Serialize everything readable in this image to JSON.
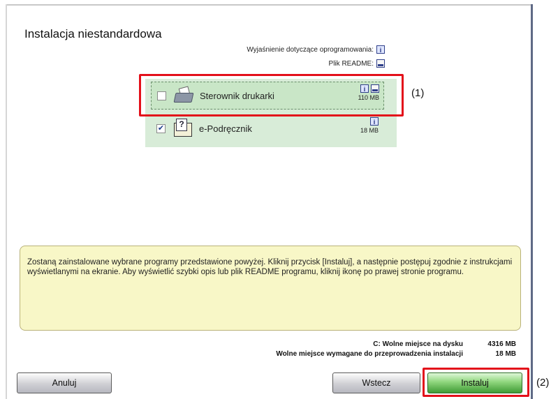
{
  "title": "Instalacja niestandardowa",
  "info": {
    "explanation_label": "Wyjaśnienie dotyczące oprogramowania:",
    "readme_label": "Plik README:"
  },
  "components": [
    {
      "label": "Sterownik drukarki",
      "checked": false,
      "size": "110 MB",
      "icon": "printer-icon"
    },
    {
      "label": "e-Podręcznik",
      "checked": true,
      "size": "18 MB",
      "icon": "manual-icon"
    }
  ],
  "callouts": {
    "c1": "(1)",
    "c2": "(2)"
  },
  "description": "Zostaną zainstalowane wybrane programy przedstawione powyżej. Kliknij przycisk [Instaluj], a następnie postępuj zgodnie z instrukcjami wyświetlanymi na ekranie. Aby wyświetlić szybki opis lub plik README programu, kliknij ikonę po prawej stronie programu.",
  "disk": {
    "free_label": "C: Wolne miejsce na dysku",
    "free_value": "4316 MB",
    "required_label": "Wolne miejsce wymagane do przeprowadzenia instalacji",
    "required_value": "18 MB"
  },
  "buttons": {
    "cancel": "Anuluj",
    "back": "Wstecz",
    "install": "Instaluj"
  },
  "colors": {
    "accent_green": "#8fd67d",
    "marker_red": "#e3101a",
    "desc_bg": "#f8f7c7",
    "list_bg": "#d8ecd8"
  }
}
